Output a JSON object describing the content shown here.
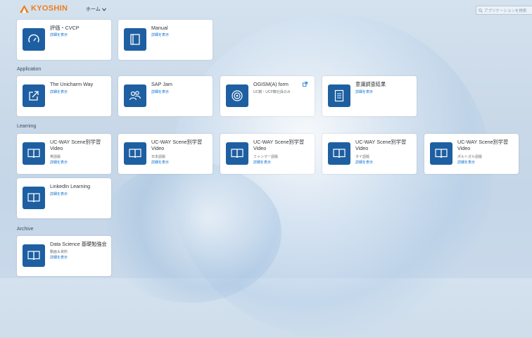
{
  "header": {
    "logo_text": "KYOSHIN",
    "home_menu": "ホーム",
    "search_placeholder": "アプリケーションを検索"
  },
  "colors": {
    "brand": "#f07d1c",
    "tile_icon": "#1e5fa2",
    "link": "#0a6ed1"
  },
  "top_tiles": [
    {
      "title": "評価・CVCP",
      "link": "詳細を表示",
      "icon": "gauge-icon"
    },
    {
      "title": "Manual",
      "link": "詳細を表示",
      "icon": "book-icon"
    }
  ],
  "sections": {
    "application": "Application",
    "learning": "Learning",
    "archive": "Archive"
  },
  "application_tiles": [
    {
      "title": "The Unicharm Way",
      "link": "詳細を表示",
      "icon": "share-icon"
    },
    {
      "title": "SAP Jam",
      "link": "詳細を表示",
      "icon": "group-icon"
    },
    {
      "title": "OGISM(A) form",
      "sub": "UC籍・UCP籍社員のみ",
      "icon": "target-icon"
    },
    {
      "title": "意識調査結果",
      "link": "詳細を表示",
      "icon": "survey-icon"
    }
  ],
  "learning_tiles": [
    {
      "title": "UC-WAY Scene別学習Video",
      "sub": "英語版",
      "link": "詳細を表示",
      "icon": "video-book-icon"
    },
    {
      "title": "UC-WAY Scene別学習Video",
      "sub": "日本語版",
      "link": "詳細を表示",
      "icon": "video-book-icon"
    },
    {
      "title": "UC-WAY Scene別学習Video",
      "sub": "ミャンマー語版",
      "link": "詳細を表示",
      "icon": "video-book-icon"
    },
    {
      "title": "UC-WAY Scene別学習Video",
      "sub": "タイ語版",
      "link": "詳細を表示",
      "icon": "video-book-icon"
    },
    {
      "title": "UC-WAY Scene別学習Video",
      "sub": "ポルトガル語版",
      "link": "詳細を表示",
      "icon": "video-book-icon"
    },
    {
      "title": "LinkedIn Learning",
      "link": "詳細を表示",
      "icon": "video-book-icon"
    }
  ],
  "archive_tiles": [
    {
      "title": "Data Science 基礎勉強会",
      "sub": "動画＆資料",
      "link": "詳細を表示",
      "icon": "video-book-icon"
    }
  ]
}
